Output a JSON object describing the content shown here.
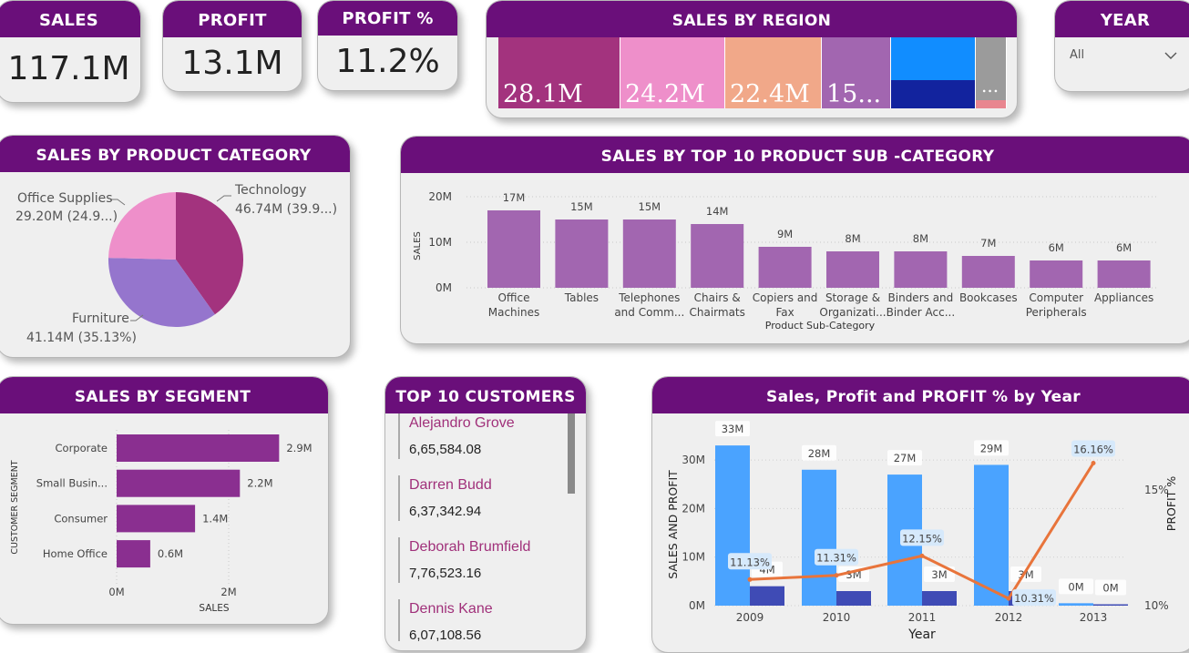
{
  "kpis": {
    "sales": {
      "label": "SALES",
      "value": "117.1M"
    },
    "profit": {
      "label": "PROFIT",
      "value": "13.1M"
    },
    "profit_pct": {
      "label": "PROFIT %",
      "value": "11.2%"
    }
  },
  "region": {
    "title": "SALES BY REGION",
    "cells": [
      {
        "label": "28.1M",
        "color": "#a3337e"
      },
      {
        "label": "24.2M",
        "color": "#ee8fca"
      },
      {
        "label": "22.4M",
        "color": "#f1a889"
      },
      {
        "label": "15...",
        "color": "#a266b0"
      },
      {
        "label": "",
        "color": "#118dff"
      },
      {
        "label": "",
        "color": "#12239e"
      },
      {
        "label": "...",
        "color": "#9b9b9b"
      },
      {
        "label": "",
        "color": "#e8868f"
      }
    ]
  },
  "year_filter": {
    "title": "YEAR",
    "selected": "All"
  },
  "category": {
    "title": "SALES BY PRODUCT CATEGORY",
    "labels": [
      {
        "name": "Office Supplies",
        "value": "29.20M (24.9...)"
      },
      {
        "name": "Technology",
        "value": "46.74M (39.9...)"
      },
      {
        "name": "Furniture",
        "value": "41.14M (35.13%)"
      }
    ]
  },
  "subcategory": {
    "title": "SALES BY TOP 10 PRODUCT SUB -CATEGORY",
    "ylabel": "SALES",
    "xlabel": "Product Sub-Category"
  },
  "segment": {
    "title": "SALES BY SEGMENT",
    "ylabel": "CUSTOMER SEGMENT",
    "xlabel": "SALES"
  },
  "customers": {
    "title": "TOP 10 CUSTOMERS",
    "items": [
      {
        "name": "Alejandro Grove",
        "value": "6,65,584.08"
      },
      {
        "name": "Darren Budd",
        "value": "6,37,342.94"
      },
      {
        "name": "Deborah Brumfield",
        "value": "7,76,523.16"
      },
      {
        "name": "Dennis Kane",
        "value": "6,07,108.56"
      }
    ]
  },
  "yearly": {
    "title": "Sales, Profit and PROFIT % by Year",
    "ylabel_left": "SALES AND PROFIT",
    "ylabel_right": "PROFIT %",
    "xlabel": "Year"
  },
  "chart_data": [
    {
      "type": "pie",
      "title": "SALES BY PRODUCT CATEGORY",
      "categories": [
        "Technology",
        "Furniture",
        "Office Supplies"
      ],
      "values": [
        46.74,
        41.14,
        29.2
      ],
      "percent_labels": [
        "39.9...",
        "35.13%",
        "24.9..."
      ],
      "colors": [
        "#a3337e",
        "#9575cd",
        "#ee8fca"
      ]
    },
    {
      "type": "bar",
      "title": "SALES BY TOP 10 PRODUCT SUB -CATEGORY",
      "categories": [
        [
          "Office",
          "Machines"
        ],
        [
          "Tables"
        ],
        [
          "Telephones",
          "and Comm..."
        ],
        [
          "Chairs &",
          "Chairmats"
        ],
        [
          "Copiers and",
          "Fax"
        ],
        [
          "Storage &",
          "Organizati..."
        ],
        [
          "Binders and",
          "Binder Acc..."
        ],
        [
          "Bookcases"
        ],
        [
          "Computer",
          "Peripherals"
        ],
        [
          "Appliances"
        ]
      ],
      "values": [
        17,
        15,
        15,
        14,
        9,
        8,
        8,
        7,
        6,
        6
      ],
      "data_labels": [
        "17M",
        "15M",
        "15M",
        "14M",
        "9M",
        "8M",
        "8M",
        "7M",
        "6M",
        "6M"
      ],
      "yticks": [
        "0M",
        "10M",
        "20M"
      ],
      "ylim": [
        0,
        20
      ],
      "xlabel": "Product Sub-Category",
      "ylabel": "SALES",
      "color": "#a266b0"
    },
    {
      "type": "bar",
      "orientation": "horizontal",
      "title": "SALES BY SEGMENT",
      "categories": [
        "Corporate",
        "Small Busin...",
        "Consumer",
        "Home Office"
      ],
      "values": [
        2.9,
        2.2,
        1.4,
        0.6
      ],
      "data_labels": [
        "2.9M",
        "2.2M",
        "1.4M",
        "0.6M"
      ],
      "xticks": [
        "0M",
        "2M"
      ],
      "xlim": [
        0,
        3.2
      ],
      "xlabel": "SALES",
      "ylabel": "CUSTOMER SEGMENT",
      "color": "#8a2f90"
    },
    {
      "type": "bar",
      "title": "Sales, Profit and PROFIT % by Year",
      "categories": [
        "2009",
        "2010",
        "2011",
        "2012",
        "2013"
      ],
      "series": [
        {
          "values": [
            33,
            28,
            27,
            29,
            0.5
          ],
          "labels": [
            "33M",
            "28M",
            "27M",
            "29M",
            "0M"
          ],
          "color": "#4aa3ff"
        },
        {
          "values": [
            4,
            3,
            3,
            3,
            0.1
          ],
          "labels": [
            "4M",
            "3M",
            "3M",
            "3M",
            "0M"
          ],
          "color": "#3f4bb5"
        },
        {
          "values": [
            11.13,
            11.31,
            12.15,
            10.31,
            16.16
          ],
          "labels": [
            "11.13%",
            "11.31%",
            "12.15%",
            "10.31%",
            "16.16%"
          ],
          "color": "#e8743b",
          "line": true
        }
      ],
      "yticks_left": [
        "0M",
        "10M",
        "20M",
        "30M"
      ],
      "ylim_left": [
        0,
        35
      ],
      "yticks_right": [
        "10%",
        "15%"
      ],
      "ylim_right": [
        10,
        17.1
      ],
      "xlabel": "Year",
      "ylabel_left": "SALES AND PROFIT",
      "ylabel_right": "PROFIT %"
    }
  ]
}
